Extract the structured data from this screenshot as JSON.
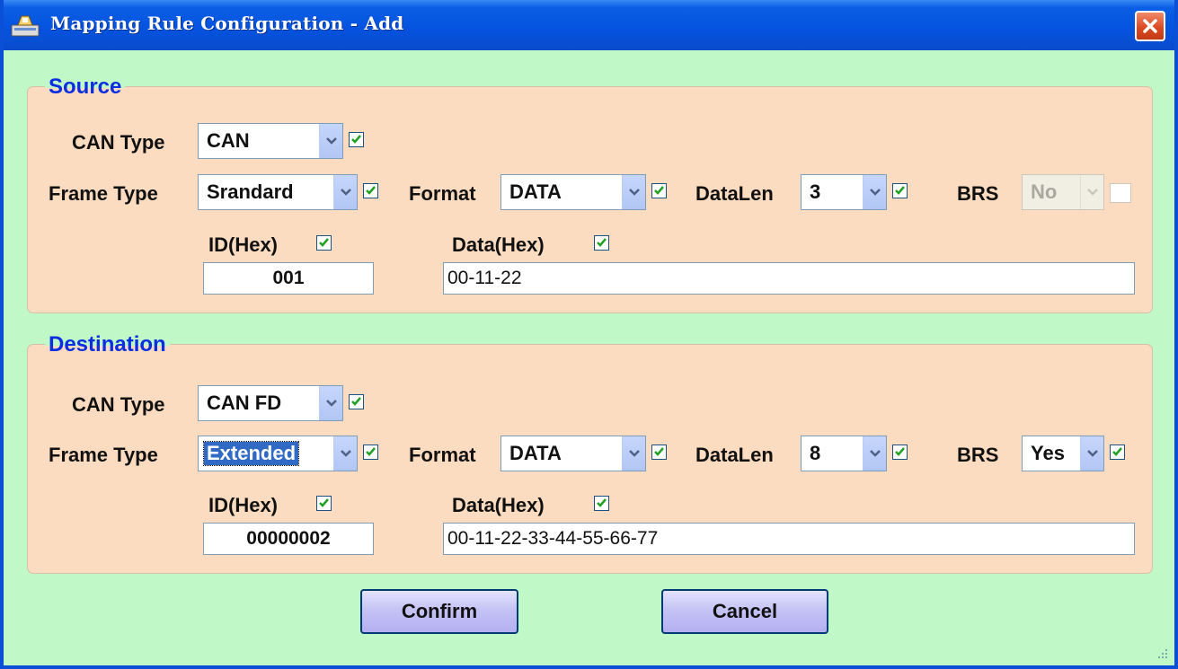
{
  "window": {
    "title": "Mapping Rule Configuration - Add"
  },
  "source": {
    "legend": "Source",
    "can_type": {
      "label": "CAN Type",
      "value": "CAN"
    },
    "frame_type": {
      "label": "Frame Type",
      "value": "Srandard"
    },
    "format": {
      "label": "Format",
      "value": "DATA"
    },
    "datalen": {
      "label": "DataLen",
      "value": "3"
    },
    "brs": {
      "label": "BRS",
      "value": "No",
      "enabled": false
    },
    "id": {
      "label": "ID(Hex)",
      "value": "001"
    },
    "data": {
      "label": "Data(Hex)",
      "value": "00-11-22"
    }
  },
  "destination": {
    "legend": "Destination",
    "can_type": {
      "label": "CAN Type",
      "value": "CAN FD"
    },
    "frame_type": {
      "label": "Frame Type",
      "value": "Extended"
    },
    "format": {
      "label": "Format",
      "value": "DATA"
    },
    "datalen": {
      "label": "DataLen",
      "value": "8"
    },
    "brs": {
      "label": "BRS",
      "value": "Yes",
      "enabled": true
    },
    "id": {
      "label": "ID(Hex)",
      "value": "00000002"
    },
    "data": {
      "label": "Data(Hex)",
      "value": "00-11-22-33-44-55-66-77"
    }
  },
  "buttons": {
    "confirm": "Confirm",
    "cancel": "Cancel"
  },
  "icons": {
    "title": "app-icon",
    "close": "close-icon",
    "dropdown": "chevron-down-icon",
    "check": "checkmark-icon",
    "resize": "resize-grip-icon"
  },
  "colors": {
    "titlebar": "#0553e0",
    "background": "#c0f8c8",
    "group": "#fcdcc0",
    "legend": "#0a2ee0",
    "checkmark": "#21a121"
  }
}
